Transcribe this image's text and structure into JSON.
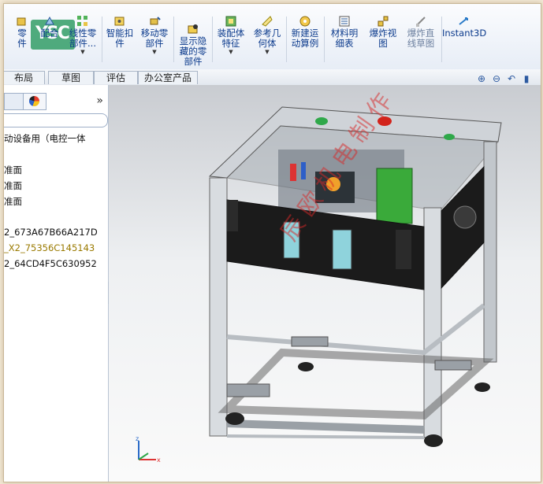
{
  "ribbon": {
    "items": [
      {
        "label": "零\n件",
        "icon": "component-icon"
      },
      {
        "label": "配合",
        "icon": "mate-icon"
      },
      {
        "label": "线性零\n部件...",
        "icon": "linear-pattern-icon",
        "dropdown": true
      },
      {
        "label": "智能扣\n件",
        "icon": "smart-fasteners-icon"
      },
      {
        "label": "移动零\n部件",
        "icon": "move-component-icon",
        "dropdown": true
      },
      {
        "label": "显示隐\n藏的零\n部件",
        "icon": "show-hidden-icon"
      },
      {
        "label": "装配体\n特征",
        "icon": "assembly-features-icon",
        "dropdown": true
      },
      {
        "label": "参考几\n何体",
        "icon": "reference-geometry-icon",
        "dropdown": true
      },
      {
        "label": "新建运\n动算例",
        "icon": "motion-study-icon"
      },
      {
        "label": "材料明\n细表",
        "icon": "bill-of-materials-icon"
      },
      {
        "label": "爆炸视\n图",
        "icon": "exploded-view-icon"
      },
      {
        "label": "爆炸直\n线草图",
        "icon": "explode-line-sketch-icon"
      },
      {
        "label": "Instant3D",
        "icon": "instant3d-icon"
      }
    ]
  },
  "tabs": [
    "布局",
    "草图",
    "评估",
    "办公室产品"
  ],
  "left_panel": {
    "more": "»",
    "tree": [
      "动设备用（电控一体",
      "准面",
      "准面",
      "准面",
      "2_673A67B66A217D",
      "_X2_75356C145143",
      "2_64CD4F5C630952"
    ]
  },
  "watermark": "辰欧机电制作",
  "colors": {
    "ribbon_text": "#0b3a8c",
    "tree_highlight": "#9a7a00",
    "frame_aluminum": "#c8ccd2",
    "panel_black": "#1b1b1b",
    "plc_green": "#3aaa3a",
    "watermark": "#d72828"
  }
}
